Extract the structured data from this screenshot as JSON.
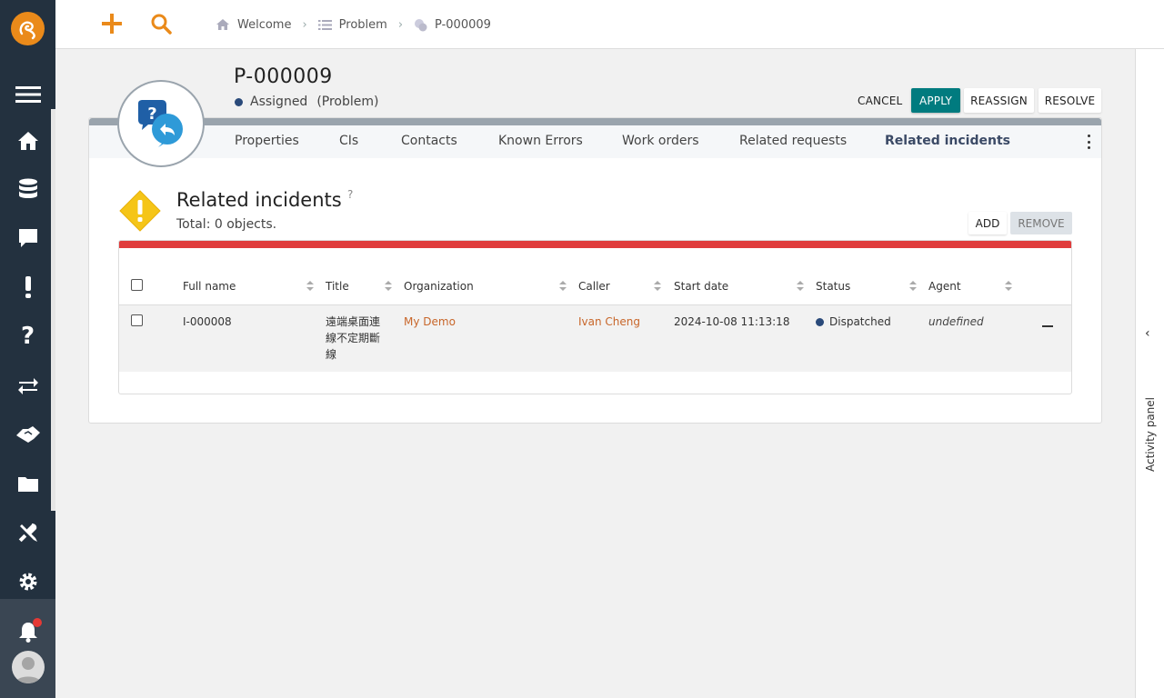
{
  "nav": {
    "items": [
      {
        "name": "menu-icon"
      },
      {
        "name": "home-icon"
      },
      {
        "name": "database-icon"
      },
      {
        "name": "chat-icon"
      },
      {
        "name": "exclamation-icon"
      },
      {
        "name": "question-icon"
      },
      {
        "name": "transfer-icon"
      },
      {
        "name": "handshake-icon"
      },
      {
        "name": "folder-icon"
      },
      {
        "name": "tools-icon"
      },
      {
        "name": "gear-icon"
      }
    ]
  },
  "breadcrumb": {
    "items": [
      {
        "icon": "home-icon",
        "label": "Welcome"
      },
      {
        "icon": "list-icon",
        "label": "Problem"
      },
      {
        "icon": "problem-icon",
        "label": "P-000009"
      }
    ]
  },
  "ticket": {
    "id": "P-000009",
    "status": "Assigned",
    "type": "(Problem)"
  },
  "actions": {
    "cancel": "CANCEL",
    "apply": "APPLY",
    "reassign": "REASSIGN",
    "resolve": "RESOLVE"
  },
  "tabs": [
    {
      "label": "Properties"
    },
    {
      "label": "CIs"
    },
    {
      "label": "Contacts"
    },
    {
      "label": "Known Errors"
    },
    {
      "label": "Work orders"
    },
    {
      "label": "Related requests"
    },
    {
      "label": "Related incidents"
    }
  ],
  "section": {
    "title": "Related incidents",
    "help": "?",
    "count": "Total: 0 objects.",
    "add": "ADD",
    "remove": "REMOVE"
  },
  "table": {
    "columns": [
      "Full name",
      "Title",
      "Organization",
      "Caller",
      "Start date",
      "Status",
      "Agent"
    ],
    "rows": [
      {
        "full_name": "I-000008",
        "title": "遠端桌面連線不定期斷線",
        "organization": "My Demo",
        "caller": "Ivan Cheng",
        "start_date": "2024-10-08 11:13:18",
        "status": "Dispatched",
        "agent": "undefined"
      }
    ]
  },
  "activity_panel": {
    "label": "Activity panel"
  },
  "colors": {
    "accent": "#ea8a1a",
    "nav_bg": "#23313f",
    "primary_button": "#007b7f",
    "danger_bar": "#e03c3c",
    "link": "#c8662a"
  }
}
